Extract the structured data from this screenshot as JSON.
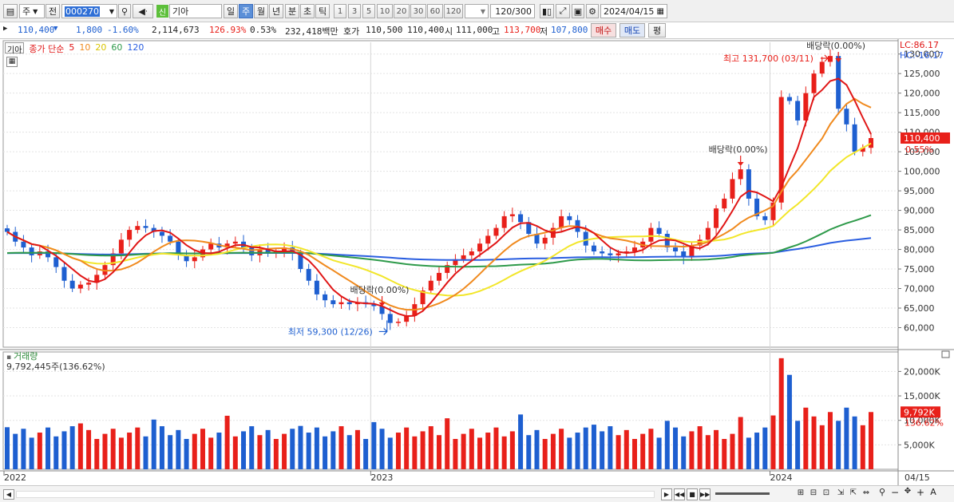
{
  "toolbar": {
    "period_select": "주",
    "prev_label": "전",
    "code": "000270",
    "stock_badge": "신",
    "stock_name": "기아",
    "periods": [
      "일",
      "주",
      "월",
      "년",
      "분",
      "초",
      "틱"
    ],
    "active_period": "주",
    "intervals": [
      "1",
      "3",
      "5",
      "10",
      "20",
      "30",
      "60",
      "120"
    ],
    "count": "120",
    "count_total": "/300",
    "date": "2024/04/15"
  },
  "quote": {
    "price": "110,400",
    "change": "1,800",
    "change_pct": "-1.60%",
    "volume": "2,114,673",
    "volume_ratio": "126.93%",
    "turnover": "0.53%",
    "amount": "232,418백만",
    "hoga_label": "호가",
    "ask": "110,500",
    "bid": "110,400",
    "open_label": "시",
    "open": "111,000",
    "high_label": "고",
    "high": "113,700",
    "low_label": "저",
    "low": "107,800",
    "buy_label": "매수",
    "sell_label": "매도",
    "eval_label": "평"
  },
  "price_pane": {
    "stock_label": "기아",
    "ma_title": "종가 단순",
    "ma_periods": [
      "5",
      "10",
      "20",
      "60",
      "120"
    ],
    "lc_label": "LC:86.17",
    "hc_label": "HC:-16.17",
    "current_price": "110,400",
    "current_pct": "0.55%",
    "high_annotation": "최고 131,700 (03/11)",
    "low_annotation": "최저 59,300 (12/26)",
    "dividend_label": "배당락(0.00%)",
    "colors": {
      "up": "#e8201a",
      "down": "#1e5fd0",
      "ma5": "#e01616",
      "ma10": "#f08a1e",
      "ma20": "#f2e62a",
      "ma60": "#2e9a4a",
      "ma120": "#2a5ee0"
    }
  },
  "volume_pane": {
    "title": "거래량",
    "value": "9,792,445주(136.62%)",
    "current": "9,792K",
    "current_pct": "136.62%"
  },
  "x_axis": {
    "labels": [
      "2022",
      "2023",
      "2024"
    ],
    "end_date": "04/15"
  },
  "chart_data": {
    "type": "candlestick",
    "title": "기아",
    "x_labels": [
      "2022",
      "2023",
      "2024"
    ],
    "ylim": [
      55000,
      133000
    ],
    "y_ticks": [
      60000,
      65000,
      70000,
      75000,
      80000,
      85000,
      90000,
      95000,
      100000,
      105000,
      110000,
      115000,
      120000,
      125000,
      130000
    ],
    "closes": [
      84500,
      82000,
      80500,
      78500,
      79500,
      78000,
      75500,
      72000,
      70000,
      71000,
      71500,
      73500,
      76000,
      79000,
      82500,
      85000,
      86000,
      85500,
      84500,
      83500,
      82000,
      78500,
      77000,
      78000,
      80000,
      81500,
      80500,
      81500,
      82000,
      80500,
      78500,
      80000,
      79000,
      79500,
      80500,
      79000,
      75000,
      72000,
      68500,
      67000,
      66000,
      66500,
      66000,
      66500,
      66000,
      65500,
      63500,
      61200,
      61500,
      63000,
      66000,
      69500,
      72000,
      74000,
      76000,
      77500,
      78500,
      79500,
      81500,
      83500,
      85500,
      88500,
      89000,
      87000,
      84000,
      81500,
      83000,
      85500,
      88500,
      87500,
      84500,
      81000,
      79500,
      79000,
      78500,
      79000,
      79500,
      80500,
      82000,
      85500,
      84000,
      80500,
      79500,
      78000,
      81000,
      82500,
      85500,
      90500,
      93000,
      98000,
      100500,
      93000,
      88500,
      87500,
      92000,
      119000,
      118000,
      113000,
      120000,
      125000,
      128000,
      129500,
      116000,
      112000,
      105000,
      106000,
      108500
    ],
    "volume_ticks": [
      "5,000K",
      "10,000K",
      "15,000K",
      "20,000K"
    ],
    "volume_max": 23000000
  },
  "icons": [
    "candle-icon",
    "search-icon",
    "speaker-icon",
    "draw-icon",
    "save-icon",
    "gear-icon",
    "calendar-icon"
  ]
}
